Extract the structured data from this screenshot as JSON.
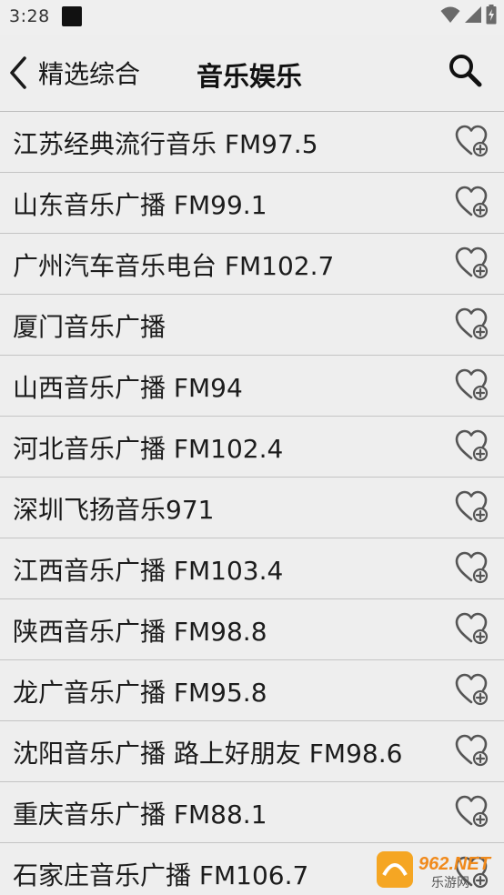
{
  "status_bar": {
    "time": "3:28"
  },
  "header": {
    "back_label": "精选综合",
    "title": "音乐娱乐"
  },
  "stations": [
    {
      "name": "江苏经典流行音乐 FM97.5"
    },
    {
      "name": "山东音乐广播 FM99.1"
    },
    {
      "name": "广州汽车音乐电台 FM102.7"
    },
    {
      "name": "厦门音乐广播"
    },
    {
      "name": "山西音乐广播 FM94"
    },
    {
      "name": "河北音乐广播 FM102.4"
    },
    {
      "name": "深圳飞扬音乐971"
    },
    {
      "name": "江西音乐广播 FM103.4"
    },
    {
      "name": "陕西音乐广播 FM98.8"
    },
    {
      "name": "龙广音乐广播 FM95.8"
    },
    {
      "name": "沈阳音乐广播 路上好朋友 FM98.6"
    },
    {
      "name": "重庆音乐广播 FM88.1"
    },
    {
      "name": "石家庄音乐广播 FM106.7"
    }
  ],
  "watermark": {
    "line1": "962.NET",
    "line2": "乐游网"
  },
  "icons": {
    "back": "chevron-left-icon",
    "search": "search-icon",
    "favorite": "heart-plus-icon",
    "wifi": "wifi-icon",
    "signal": "signal-icon",
    "battery": "battery-charging-icon"
  },
  "colors": {
    "background": "#eeeeee",
    "divider": "#c4c4c4",
    "text": "#1c1c1c",
    "icon": "#555555"
  }
}
